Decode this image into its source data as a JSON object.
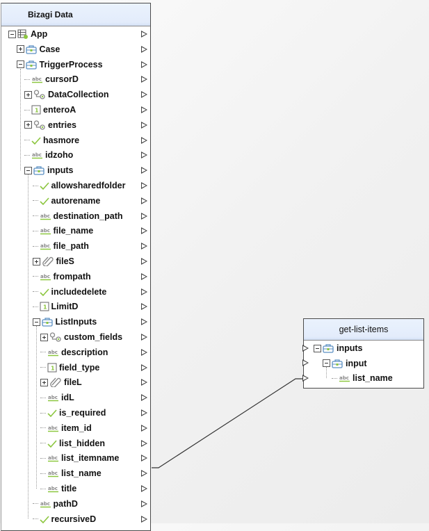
{
  "left_panel": {
    "title": "Bizagi Data",
    "rows": [
      {
        "label": "App",
        "level": 0,
        "icon": "entity-icon",
        "toggle": "minus"
      },
      {
        "label": "Case",
        "level": 1,
        "icon": "object-icon",
        "toggle": "plus"
      },
      {
        "label": "TriggerProcess",
        "level": 1,
        "icon": "object-icon",
        "toggle": "minus"
      },
      {
        "label": "cursorD",
        "level": 2,
        "icon": "string-icon",
        "toggle": "none"
      },
      {
        "label": "DataCollection",
        "level": 2,
        "icon": "collection-icon",
        "toggle": "plus"
      },
      {
        "label": "enteroA",
        "level": 2,
        "icon": "integer-icon",
        "toggle": "none"
      },
      {
        "label": "entries",
        "level": 2,
        "icon": "collection-icon",
        "toggle": "plus"
      },
      {
        "label": "hasmore",
        "level": 2,
        "icon": "boolean-icon",
        "toggle": "none"
      },
      {
        "label": "idzoho",
        "level": 2,
        "icon": "string-icon",
        "toggle": "none"
      },
      {
        "label": "inputs",
        "level": 2,
        "icon": "object-icon",
        "toggle": "minus"
      },
      {
        "label": "allowsharedfolder",
        "level": 3,
        "icon": "boolean-icon",
        "toggle": "none"
      },
      {
        "label": "autorename",
        "level": 3,
        "icon": "boolean-icon",
        "toggle": "none"
      },
      {
        "label": "destination_path",
        "level": 3,
        "icon": "string-icon",
        "toggle": "none"
      },
      {
        "label": "file_name",
        "level": 3,
        "icon": "string-icon",
        "toggle": "none"
      },
      {
        "label": "file_path",
        "level": 3,
        "icon": "string-icon",
        "toggle": "none"
      },
      {
        "label": "fileS",
        "level": 3,
        "icon": "file-icon",
        "toggle": "plus"
      },
      {
        "label": "frompath",
        "level": 3,
        "icon": "string-icon",
        "toggle": "none"
      },
      {
        "label": "includedelete",
        "level": 3,
        "icon": "boolean-icon",
        "toggle": "none"
      },
      {
        "label": "LimitD",
        "level": 3,
        "icon": "integer-icon",
        "toggle": "none"
      },
      {
        "label": "ListInputs",
        "level": 3,
        "icon": "object-icon",
        "toggle": "minus"
      },
      {
        "label": "custom_fields",
        "level": 4,
        "icon": "collection-icon",
        "toggle": "plus"
      },
      {
        "label": "description",
        "level": 4,
        "icon": "string-icon",
        "toggle": "none"
      },
      {
        "label": "field_type",
        "level": 4,
        "icon": "integer-icon",
        "toggle": "none"
      },
      {
        "label": "fileL",
        "level": 4,
        "icon": "file-icon",
        "toggle": "plus"
      },
      {
        "label": "idL",
        "level": 4,
        "icon": "string-icon",
        "toggle": "none"
      },
      {
        "label": "is_required",
        "level": 4,
        "icon": "boolean-icon",
        "toggle": "none"
      },
      {
        "label": "item_id",
        "level": 4,
        "icon": "string-icon",
        "toggle": "none"
      },
      {
        "label": "list_hidden",
        "level": 4,
        "icon": "boolean-icon",
        "toggle": "none"
      },
      {
        "label": "list_itemname",
        "level": 4,
        "icon": "string-icon",
        "toggle": "none"
      },
      {
        "label": "list_name",
        "level": 4,
        "icon": "string-icon",
        "toggle": "none"
      },
      {
        "label": "title",
        "level": 4,
        "icon": "string-icon",
        "toggle": "none"
      },
      {
        "label": "pathD",
        "level": 3,
        "icon": "string-icon",
        "toggle": "none"
      },
      {
        "label": "recursiveD",
        "level": 3,
        "icon": "boolean-icon",
        "toggle": "none"
      }
    ]
  },
  "right_panel": {
    "title": "get-list-items",
    "rows": [
      {
        "label": "inputs",
        "level": 0,
        "icon": "object-icon",
        "toggle": "minus"
      },
      {
        "label": "input",
        "level": 1,
        "icon": "object-icon",
        "toggle": "minus"
      },
      {
        "label": "list_name",
        "level": 2,
        "icon": "string-icon",
        "toggle": "none"
      }
    ]
  },
  "mapping": {
    "from": "Bizagi Data/App/TriggerProcess/inputs/ListInputs/list_name",
    "to": "get-list-items/inputs/input/list_name"
  },
  "colors": {
    "accent_green": "#8cc63f",
    "icon_blue": "#5a8fc2",
    "header_blue": "#e3ecfb",
    "border": "#4a4a4a"
  }
}
